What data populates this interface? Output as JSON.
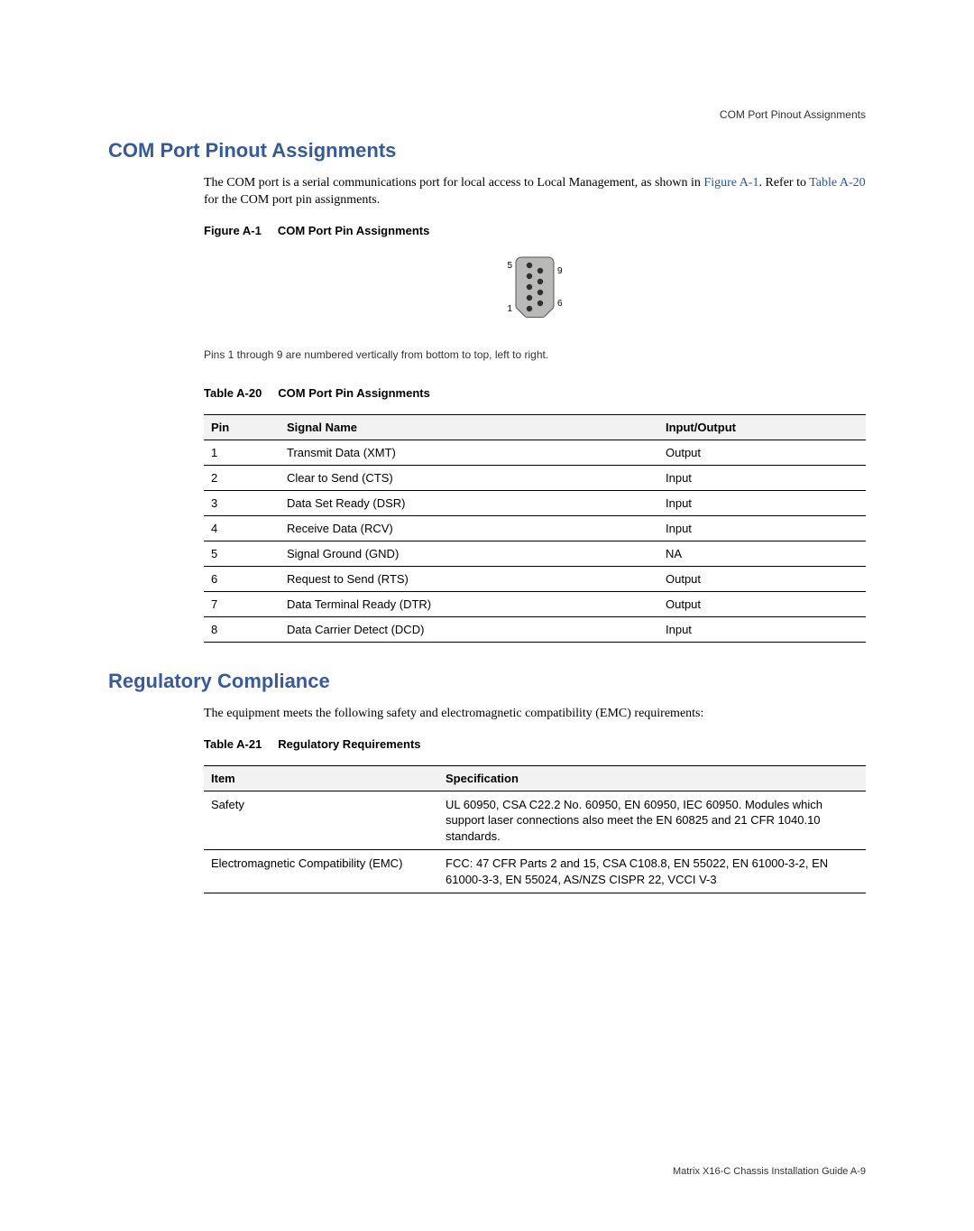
{
  "header": {
    "running_head": "COM Port Pinout Assignments"
  },
  "section1": {
    "title": "COM Port Pinout Assignments",
    "intro_part1": "The COM port is a serial communications port for local access to Local Management, as shown in ",
    "intro_link1": "Figure A-1",
    "intro_part2": ". Refer to ",
    "intro_link2": "Table A-20",
    "intro_part3": " for the COM port pin assignments."
  },
  "figure": {
    "label": "Figure A-1",
    "title": "COM Port Pin Assignments",
    "note": "Pins 1 through 9 are numbered vertically from bottom to top, left to right.",
    "pin_left_top": "5",
    "pin_left_bottom": "1",
    "pin_right_top": "9",
    "pin_right_bottom": "6"
  },
  "table20": {
    "label": "Table A-20",
    "title": "COM Port Pin Assignments",
    "headers": {
      "pin": "Pin",
      "signal": "Signal Name",
      "io": "Input/Output"
    },
    "rows": [
      {
        "pin": "1",
        "signal": "Transmit Data (XMT)",
        "io": "Output"
      },
      {
        "pin": "2",
        "signal": "Clear to Send (CTS)",
        "io": "Input"
      },
      {
        "pin": "3",
        "signal": "Data Set Ready (DSR)",
        "io": "Input"
      },
      {
        "pin": "4",
        "signal": "Receive Data (RCV)",
        "io": "Input"
      },
      {
        "pin": "5",
        "signal": "Signal Ground (GND)",
        "io": "NA"
      },
      {
        "pin": "6",
        "signal": "Request to Send (RTS)",
        "io": "Output"
      },
      {
        "pin": "7",
        "signal": "Data Terminal Ready (DTR)",
        "io": "Output"
      },
      {
        "pin": "8",
        "signal": "Data Carrier Detect (DCD)",
        "io": "Input"
      }
    ]
  },
  "section2": {
    "title": "Regulatory Compliance",
    "intro": "The equipment meets the following safety and electromagnetic compatibility (EMC) requirements:"
  },
  "table21": {
    "label": "Table A-21",
    "title": "Regulatory Requirements",
    "headers": {
      "item": "Item",
      "spec": "Specification"
    },
    "rows": [
      {
        "item": "Safety",
        "spec": "UL 60950, CSA C22.2 No. 60950, EN 60950, IEC 60950. Modules which support laser connections also meet the EN 60825 and 21 CFR 1040.10 standards."
      },
      {
        "item": "Electromagnetic Compatibility (EMC)",
        "spec": "FCC: 47 CFR Parts 2 and 15, CSA C108.8, EN 55022, EN 61000-3-2, EN 61000-3-3, EN 55024, AS/NZS CISPR 22, VCCI V-3"
      }
    ]
  },
  "footer": {
    "text": "Matrix X16-C Chassis Installation Guide   A-9"
  }
}
